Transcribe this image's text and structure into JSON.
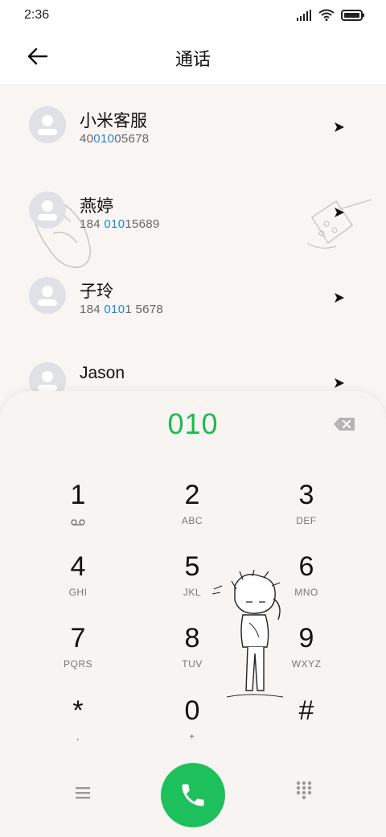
{
  "status_bar": {
    "time": "2:36"
  },
  "header": {
    "title": "通话"
  },
  "contacts": [
    {
      "name": "小米客服",
      "number_pre": "40",
      "number_hl": "010",
      "number_post": "05678"
    },
    {
      "name": "燕婷",
      "number_pre": "184 ",
      "number_hl": "010",
      "number_post": "15689"
    },
    {
      "name": "子玲",
      "number_pre": "184 ",
      "number_hl": "010",
      "number_post": "1 5678"
    },
    {
      "name": "Jason",
      "number_pre": "",
      "number_hl": "",
      "number_post": ""
    }
  ],
  "dialer": {
    "input": "010",
    "keys": [
      {
        "digit": "1",
        "sub": ""
      },
      {
        "digit": "2",
        "sub": "ABC"
      },
      {
        "digit": "3",
        "sub": "DEF"
      },
      {
        "digit": "4",
        "sub": "GHI"
      },
      {
        "digit": "5",
        "sub": "JKL"
      },
      {
        "digit": "6",
        "sub": "MNO"
      },
      {
        "digit": "7",
        "sub": "PQRS"
      },
      {
        "digit": "8",
        "sub": "TUV"
      },
      {
        "digit": "9",
        "sub": "WXYZ"
      },
      {
        "digit": "*",
        "sub": ","
      },
      {
        "digit": "0",
        "sub": "+"
      },
      {
        "digit": "#",
        "sub": ""
      }
    ]
  },
  "colors": {
    "accent_green": "#1db954",
    "call_button": "#1ec05b",
    "number_highlight": "#1e88d6"
  },
  "icons": [
    "signal-icon",
    "wifi-icon",
    "battery-icon",
    "back-arrow-icon",
    "avatar-icon",
    "play-arrow-icon",
    "backspace-icon",
    "voicemail-icon",
    "menu-icon",
    "phone-icon",
    "keypad-icon"
  ]
}
